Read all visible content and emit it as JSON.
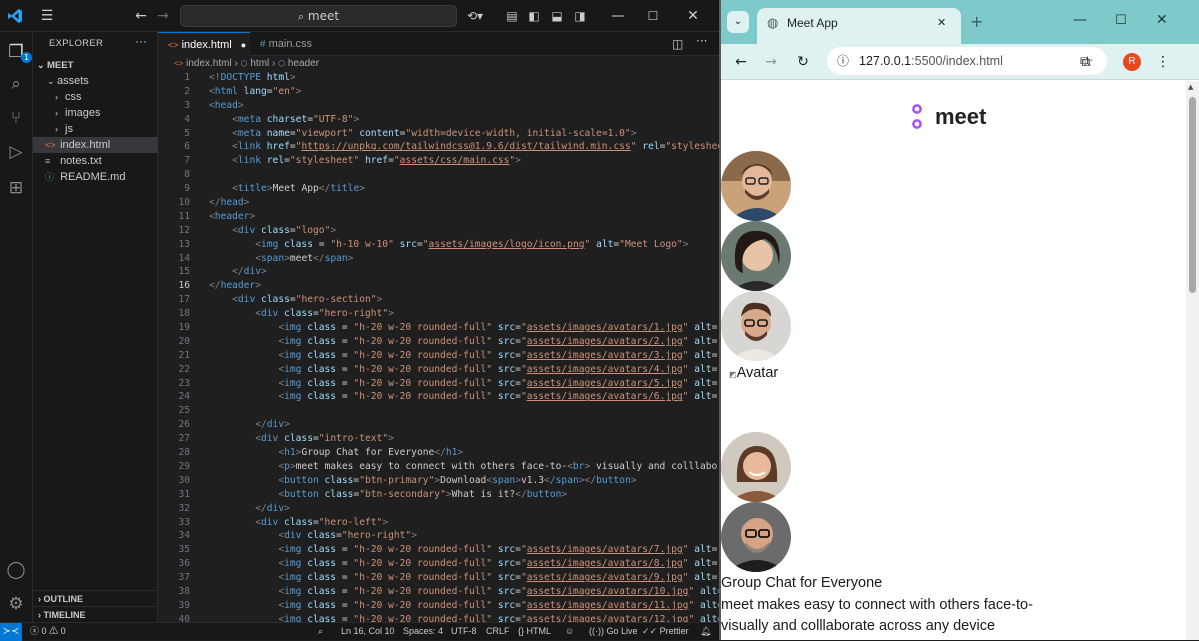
{
  "vscode": {
    "search": "meet",
    "sidebar": {
      "title": "EXPLORER",
      "root": "MEET",
      "items": [
        {
          "label": "assets",
          "kind": "folder-open",
          "depth": 1
        },
        {
          "label": "css",
          "kind": "folder",
          "depth": 2
        },
        {
          "label": "images",
          "kind": "folder",
          "depth": 2
        },
        {
          "label": "js",
          "kind": "folder",
          "depth": 2
        },
        {
          "label": "index.html",
          "kind": "html",
          "depth": 1,
          "selected": true
        },
        {
          "label": "notes.txt",
          "kind": "txt",
          "depth": 1
        },
        {
          "label": "README.md",
          "kind": "md",
          "depth": 1
        }
      ],
      "outline": "OUTLINE",
      "timeline": "TIMELINE"
    },
    "explorer_badge": "1",
    "tabs": [
      {
        "label": "index.html",
        "active": true,
        "icon": "<>",
        "modified": true
      },
      {
        "label": "main.css",
        "active": false,
        "icon": "#"
      }
    ],
    "breadcrumb": [
      "index.html",
      "html",
      "header"
    ],
    "current_line": 16,
    "code_lines": [
      {
        "n": 1,
        "html": "<span class='b'>&lt;!</span><span class='t'>DOCTYPE</span> <span class='a'>html</span><span class='b'>&gt;</span>"
      },
      {
        "n": 2,
        "html": "<span class='b'>&lt;</span><span class='t'>html</span> <span class='a'>lang</span>=<span class='s'>\"en\"</span><span class='b'>&gt;</span>"
      },
      {
        "n": 3,
        "html": "<span class='b'>&lt;</span><span class='t'>head</span><span class='b'>&gt;</span>"
      },
      {
        "n": 4,
        "html": "    <span class='b'>&lt;</span><span class='t'>meta</span> <span class='a'>charset</span>=<span class='s'>\"UTF-8\"</span><span class='b'>&gt;</span>"
      },
      {
        "n": 5,
        "html": "    <span class='b'>&lt;</span><span class='t'>meta</span> <span class='a'>name</span>=<span class='s'>\"viewport\"</span> <span class='a'>content</span>=<span class='s'>\"width=device-width, initial-scale=1.0\"</span><span class='b'>&gt;</span>"
      },
      {
        "n": 6,
        "html": "    <span class='b'>&lt;</span><span class='t'>link</span> <span class='a'>href</span>=<span class='s'>\"<span class='u'>https://unpkg.com/tailwindcss@1.9.6/dist/tailwind.min.css</span>\"</span> <span class='a'>rel</span>=<span class='s'>\"stylesheet</span>"
      },
      {
        "n": 7,
        "html": "    <span class='b'>&lt;</span><span class='t'>link</span> <span class='a'>rel</span>=<span class='s'>\"stylesheet\"</span> <span class='a'>href</span>=<span class='s'>\"<span class='u'>assets/css/main.css</span>\"</span><span class='b'>&gt;</span>"
      },
      {
        "n": 8,
        "html": ""
      },
      {
        "n": 9,
        "html": "    <span class='b'>&lt;</span><span class='t'>title</span><span class='b'>&gt;</span><span class='tx'>Meet App</span><span class='b'>&lt;/</span><span class='t'>title</span><span class='b'>&gt;</span>"
      },
      {
        "n": 10,
        "html": "<span class='b'>&lt;/</span><span class='t'>head</span><span class='b'>&gt;</span>"
      },
      {
        "n": 11,
        "html": "<span class='b'>&lt;</span><span class='t'>header</span><span class='b'>&gt;</span>"
      },
      {
        "n": 12,
        "html": "    <span class='b'>&lt;</span><span class='t'>div</span> <span class='a'>class</span>=<span class='s'>\"logo\"</span><span class='b'>&gt;</span>"
      },
      {
        "n": 13,
        "html": "        <span class='b'>&lt;</span><span class='t'>img</span> <span class='a'>class</span> = <span class='s'>\"h-10 w-10\"</span> <span class='a'>src</span>=<span class='s'>\"<span class='u'>assets/images/logo/icon.png</span>\"</span> <span class='a'>alt</span>=<span class='s'>\"Meet Logo\"</span><span class='b'>&gt;</span>"
      },
      {
        "n": 14,
        "html": "        <span class='b'>&lt;</span><span class='t'>span</span><span class='b'>&gt;</span><span class='tx'>meet</span><span class='b'>&lt;/</span><span class='t'>span</span><span class='b'>&gt;</span>"
      },
      {
        "n": 15,
        "html": "    <span class='b'>&lt;/</span><span class='t'>div</span><span class='b'>&gt;</span>"
      },
      {
        "n": 16,
        "html": "<span class='b'>&lt;/</span><span class='t'>header</span><span class='b'>&gt;</span>"
      },
      {
        "n": 17,
        "html": "    <span class='b'>&lt;</span><span class='t'>div</span> <span class='a'>class</span>=<span class='s'>\"hero-section\"</span><span class='b'>&gt;</span>"
      },
      {
        "n": 18,
        "html": "        <span class='b'>&lt;</span><span class='t'>div</span> <span class='a'>class</span>=<span class='s'>\"hero-right\"</span><span class='b'>&gt;</span>"
      },
      {
        "n": 19,
        "html": "            <span class='b'>&lt;</span><span class='t'>img</span> <span class='a'>class</span> = <span class='s'>\"h-20 w-20 rounded-full\"</span> <span class='a'>src</span>=<span class='s'>\"<span class='u'>assets/images/avatars/1.jpg</span>\"</span> <span class='a'>alt</span>=<span class='s'>\"A</span>"
      },
      {
        "n": 20,
        "html": "            <span class='b'>&lt;</span><span class='t'>img</span> <span class='a'>class</span> = <span class='s'>\"h-20 w-20 rounded-full\"</span> <span class='a'>src</span>=<span class='s'>\"<span class='u'>assets/images/avatars/2.jpg</span>\"</span> <span class='a'>alt</span>=<span class='s'>\"A</span>"
      },
      {
        "n": 21,
        "html": "            <span class='b'>&lt;</span><span class='t'>img</span> <span class='a'>class</span> = <span class='s'>\"h-20 w-20 rounded-full\"</span> <span class='a'>src</span>=<span class='s'>\"<span class='u'>assets/images/avatars/3.jpg</span>\"</span> <span class='a'>alt</span>=<span class='s'>\"A</span>"
      },
      {
        "n": 22,
        "html": "            <span class='b'>&lt;</span><span class='t'>img</span> <span class='a'>class</span> = <span class='s'>\"h-20 w-20 rounded-full\"</span> <span class='a'>src</span>=<span class='s'>\"<span class='u'>assets/images/avatars/4.jpg</span>\"</span> <span class='a'>alt</span>=<span class='s'>\"A</span>"
      },
      {
        "n": 23,
        "html": "            <span class='b'>&lt;</span><span class='t'>img</span> <span class='a'>class</span> = <span class='s'>\"h-20 w-20 rounded-full\"</span> <span class='a'>src</span>=<span class='s'>\"<span class='u'>assets/images/avatars/5.jpg</span>\"</span> <span class='a'>alt</span>=<span class='s'>\"A</span>"
      },
      {
        "n": 24,
        "html": "            <span class='b'>&lt;</span><span class='t'>img</span> <span class='a'>class</span> = <span class='s'>\"h-20 w-20 rounded-full\"</span> <span class='a'>src</span>=<span class='s'>\"<span class='u'>assets/images/avatars/6.jpg</span>\"</span> <span class='a'>alt</span>=<span class='s'>\"A</span>"
      },
      {
        "n": 25,
        "html": ""
      },
      {
        "n": 26,
        "html": "        <span class='b'>&lt;/</span><span class='t'>div</span><span class='b'>&gt;</span>"
      },
      {
        "n": 27,
        "html": "        <span class='b'>&lt;</span><span class='t'>div</span> <span class='a'>class</span>=<span class='s'>\"intro-text\"</span><span class='b'>&gt;</span>"
      },
      {
        "n": 28,
        "html": "            <span class='b'>&lt;</span><span class='t'>h1</span><span class='b'>&gt;</span><span class='tx'>Group Chat for Everyone</span><span class='b'>&lt;/</span><span class='t'>h1</span><span class='b'>&gt;</span>"
      },
      {
        "n": 29,
        "html": "            <span class='b'>&lt;</span><span class='t'>p</span><span class='b'>&gt;</span><span class='tx'>meet makes easy to connect with others face-to-</span><span class='b'>&lt;</span><span class='t'>br</span><span class='b'>&gt;</span><span class='tx'> visually and colllabora</span>"
      },
      {
        "n": 30,
        "html": "            <span class='b'>&lt;</span><span class='t'>button</span> <span class='a'>class</span>=<span class='s'>\"btn-primary\"</span><span class='b'>&gt;</span><span class='tx'>Download</span><span class='b'>&lt;</span><span class='t'>span</span><span class='b'>&gt;</span><span class='tx'>v1.3</span><span class='b'>&lt;/</span><span class='t'>span</span><span class='b'>&gt;&lt;/</span><span class='t'>button</span><span class='b'>&gt;</span>"
      },
      {
        "n": 31,
        "html": "            <span class='b'>&lt;</span><span class='t'>button</span> <span class='a'>class</span>=<span class='s'>\"btn-secondary\"</span><span class='b'>&gt;</span><span class='tx'>What is it?</span><span class='b'>&lt;/</span><span class='t'>button</span><span class='b'>&gt;</span>"
      },
      {
        "n": 32,
        "html": "        <span class='b'>&lt;/</span><span class='t'>div</span><span class='b'>&gt;</span>"
      },
      {
        "n": 33,
        "html": "        <span class='b'>&lt;</span><span class='t'>div</span> <span class='a'>class</span>=<span class='s'>\"hero-left\"</span><span class='b'>&gt;</span>"
      },
      {
        "n": 34,
        "html": "            <span class='b'>&lt;</span><span class='t'>div</span> <span class='a'>class</span>=<span class='s'>\"hero-right\"</span><span class='b'>&gt;</span>"
      },
      {
        "n": 35,
        "html": "            <span class='b'>&lt;</span><span class='t'>img</span> <span class='a'>class</span> = <span class='s'>\"h-20 w-20 rounded-full\"</span> <span class='a'>src</span>=<span class='s'>\"<span class='u'>assets/images/avatars/7.jpg</span>\"</span> <span class='a'>alt</span>=<span class='s'>\"A</span>"
      },
      {
        "n": 36,
        "html": "            <span class='b'>&lt;</span><span class='t'>img</span> <span class='a'>class</span> = <span class='s'>\"h-20 w-20 rounded-full\"</span> <span class='a'>src</span>=<span class='s'>\"<span class='u'>assets/images/avatars/8.jpg</span>\"</span> <span class='a'>alt</span>=<span class='s'>\"A</span>"
      },
      {
        "n": 37,
        "html": "            <span class='b'>&lt;</span><span class='t'>img</span> <span class='a'>class</span> = <span class='s'>\"h-20 w-20 rounded-full\"</span> <span class='a'>src</span>=<span class='s'>\"<span class='u'>assets/images/avatars/9.jpg</span>\"</span> <span class='a'>alt</span>=<span class='s'>\"A</span>"
      },
      {
        "n": 38,
        "html": "            <span class='b'>&lt;</span><span class='t'>img</span> <span class='a'>class</span> = <span class='s'>\"h-20 w-20 rounded-full\"</span> <span class='a'>src</span>=<span class='s'>\"<span class='u'>assets/images/avatars/10.jpg</span>\"</span> <span class='a'>alt</span>=<span class='s'>\"</span>"
      },
      {
        "n": 39,
        "html": "            <span class='b'>&lt;</span><span class='t'>img</span> <span class='a'>class</span> = <span class='s'>\"h-20 w-20 rounded-full\"</span> <span class='a'>src</span>=<span class='s'>\"<span class='u'>assets/images/avatars/11.jpg</span>\"</span> <span class='a'>alt</span>=<span class='s'>\"</span>"
      },
      {
        "n": 40,
        "html": "            <span class='b'>&lt;</span><span class='t'>img</span> <span class='a'>class</span> = <span class='s'>\"h-20 w-20 rounded-full\"</span> <span class='a'>src</span>=<span class='s'>\"<span class='u'>assets/images/avatars/12.jpg</span>\"</span> <span class='a'>alt</span>=<span class='s'>\"</span>"
      }
    ],
    "status": {
      "errors": "0",
      "warnings": "0",
      "position": "Ln 16, Col 10",
      "spaces": "Spaces: 4",
      "encoding": "UTF-8",
      "eol": "CRLF",
      "language": "HTML",
      "golive": "Go Live",
      "prettier": "Prettier"
    }
  },
  "browser": {
    "tab_title": "Meet App",
    "url_host": "127.0.0.1",
    "url_rest": ":5500/index.html",
    "profile_initial": "R",
    "page": {
      "logo_text": "meet",
      "broken_alt": "Avatar",
      "heading": "Group Chat for Everyone",
      "line1": "meet makes easy to connect with others face-to-",
      "line2": "visually and colllaborate across any device"
    }
  },
  "colors": {
    "accent": "#0078d4",
    "logo_dot": "#a855f7",
    "browser_frame": "#7ec9c9",
    "profile_badge": "#e8491d"
  }
}
